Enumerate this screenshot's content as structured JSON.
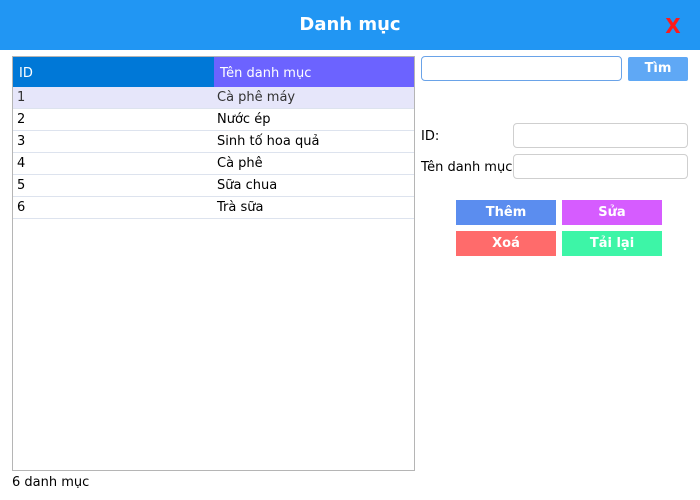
{
  "window": {
    "title": "Danh mục",
    "close_label": "X",
    "title_bar_color": "#2196f3"
  },
  "table": {
    "headers": {
      "id": "ID",
      "name": "Tên danh mục"
    },
    "header_colors": {
      "id": "#0078d7",
      "name": "#6c63ff"
    },
    "rows": [
      {
        "id": "1",
        "name": "Cà phê máy"
      },
      {
        "id": "2",
        "name": "Nước ép"
      },
      {
        "id": "3",
        "name": "Sinh tố hoa quả"
      },
      {
        "id": "4",
        "name": "Cà phê"
      },
      {
        "id": "5",
        "name": "Sữa chua"
      },
      {
        "id": "6",
        "name": "Trà sữa"
      }
    ],
    "selected_row": 0
  },
  "search": {
    "value": "",
    "button_label": "Tìm"
  },
  "form": {
    "id_label": "ID:",
    "id_value": "",
    "name_label": "Tên danh mục:",
    "name_value": ""
  },
  "actions": {
    "add_label": "Thêm",
    "edit_label": "Sửa",
    "delete_label": "Xoá",
    "reload_label": "Tải lại"
  },
  "status": {
    "text": "6 danh mục"
  }
}
